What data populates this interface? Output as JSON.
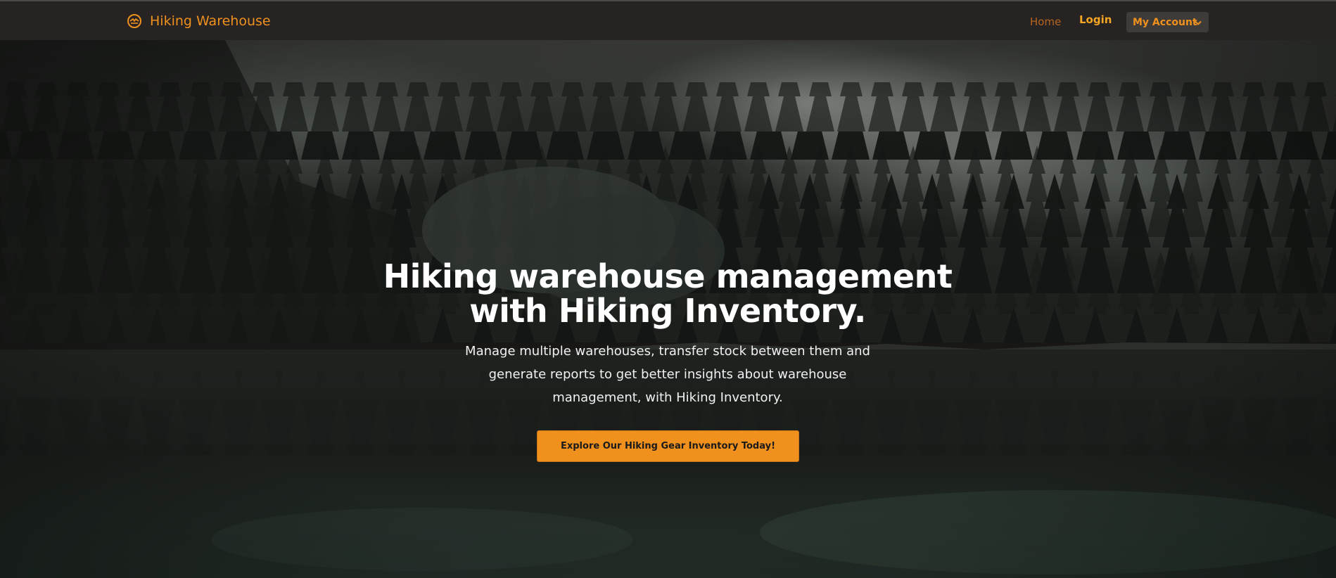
{
  "navbar": {
    "brand_name": "Hiking Warehouse",
    "brand_icon": "hiker-icon",
    "home_label": "Home",
    "login_label": "Login",
    "account_label": "My Account",
    "account_icon": "chevron-down-icon"
  },
  "hero": {
    "title_line1": "Hiking warehouse management",
    "title_line2": "with Hiking Inventory.",
    "subtitle": "Manage multiple warehouses, transfer stock between them and generate reports to get better insights about warehouse management, with Hiking Inventory.",
    "cta_label": "Explore Our Hiking Gear Inventory Today!"
  },
  "colors": {
    "accent": "#f0911e",
    "navbar_bg": "#262322",
    "account_btn_bg": "#3e3b38",
    "home_link": "#b8651f",
    "login_link": "#f5a623",
    "title_text": "#ffffff"
  }
}
